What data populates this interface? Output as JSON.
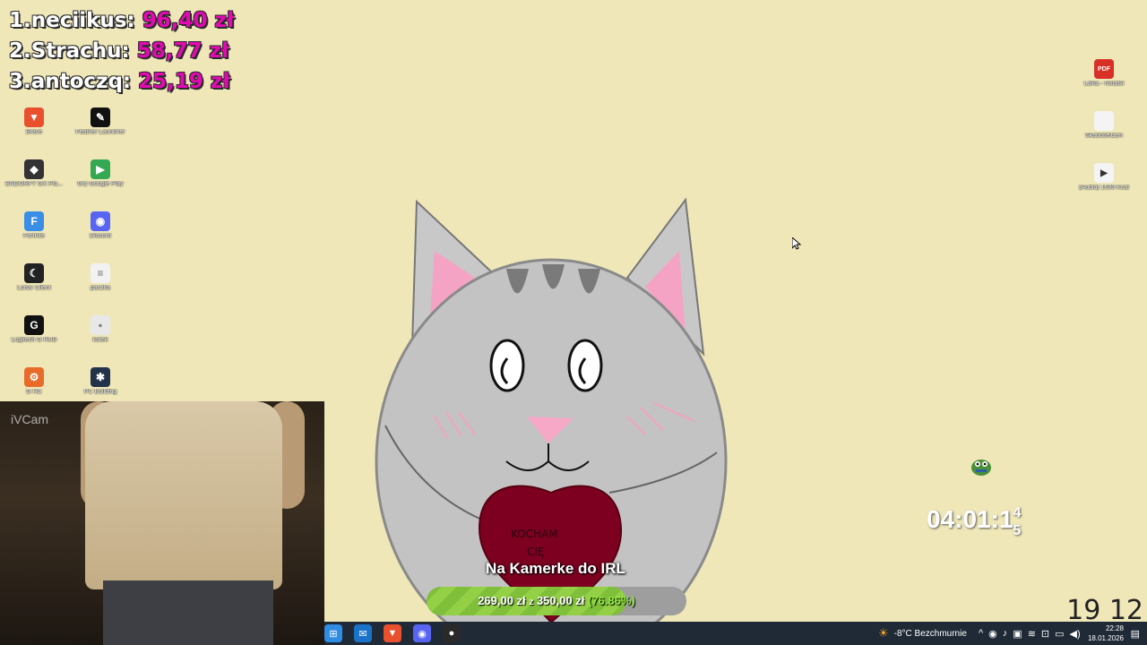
{
  "leaderboard": [
    {
      "rank_name": "1.neciikus:",
      "amount": "96,40 zł"
    },
    {
      "rank_name": "2.Strachu:",
      "amount": "58,77 zł"
    },
    {
      "rank_name": "3.antoczq:",
      "amount": "25,19 zł"
    }
  ],
  "desktop_left": [
    {
      "label": "Brave",
      "icon": "brave-icon",
      "color": "#e8502e",
      "glyph": "▼"
    },
    {
      "label": "Feather Launcher",
      "icon": "feather-icon",
      "color": "#111111",
      "glyph": "✎"
    },
    {
      "label": "ENDORFY GX Plu...",
      "icon": "endorfy-icon",
      "color": "#333333",
      "glyph": "◆"
    },
    {
      "label": "Gry Google Play",
      "icon": "google-play-icon",
      "color": "#34a853",
      "glyph": "▶"
    },
    {
      "label": "Fortnite",
      "icon": "fortnite-icon",
      "color": "#3a8ee6",
      "glyph": "F"
    },
    {
      "label": "Discord",
      "icon": "discord-icon",
      "color": "#5865f2",
      "glyph": "◉"
    },
    {
      "label": "Lunar Client",
      "icon": "lunar-client-icon",
      "color": "#222222",
      "glyph": "☾"
    },
    {
      "label": "paczka",
      "icon": "text-file-icon",
      "color": "#f2f2f2",
      "glyph": "≡"
    },
    {
      "label": "Logitech G HUB",
      "icon": "logitech-icon",
      "color": "#111111",
      "glyph": "G"
    },
    {
      "label": "kotek",
      "icon": "image-file-icon",
      "color": "#e8e8e8",
      "glyph": "▪"
    },
    {
      "label": "G HC",
      "icon": "ghc-icon",
      "color": "#e86b2a",
      "glyph": "⚙"
    },
    {
      "label": "PC Building",
      "icon": "pc-building-icon",
      "color": "#23344a",
      "glyph": "✱"
    }
  ],
  "desktop_right": [
    {
      "label": "Lalka - Notatki",
      "icon": "pdf-icon",
      "color": "#d93025",
      "glyph": "PDF"
    },
    {
      "label": "Skadošeltzen",
      "icon": "blank-file-icon",
      "color": "#f4f4f4",
      "glyph": ""
    },
    {
      "label": "(Audio) 1500 Kcal",
      "icon": "audio-file-icon",
      "color": "#f4f4f4",
      "glyph": "▶"
    }
  ],
  "webcam": {
    "label": "iVCam"
  },
  "goal": {
    "title": "Na Kamerke do IRL",
    "current": "269,00 zł",
    "sep": "z",
    "target": "350,00 zł",
    "percent_label": "(76.86%)",
    "progress": 0.7686
  },
  "timer": {
    "value": "04:01:1",
    "sup": "4",
    "sub": "5"
  },
  "doodle": "19 12",
  "taskbar": {
    "apps": [
      {
        "name": "start-button",
        "icon": "windows-icon",
        "color": "#2f8de4",
        "glyph": "⊞"
      },
      {
        "name": "outlook-button",
        "icon": "outlook-icon",
        "color": "#1a73c8",
        "glyph": "✉"
      },
      {
        "name": "brave-button",
        "icon": "brave-icon",
        "color": "#e8502e",
        "glyph": "▼"
      },
      {
        "name": "discord-button",
        "icon": "discord-icon",
        "color": "#5865f2",
        "glyph": "◉"
      },
      {
        "name": "obs-button",
        "icon": "obs-icon",
        "color": "#2a2a2a",
        "glyph": "●"
      }
    ],
    "weather": "-8°C  Bezchmurnie",
    "time": "22:28",
    "date": "18.01.2026"
  }
}
